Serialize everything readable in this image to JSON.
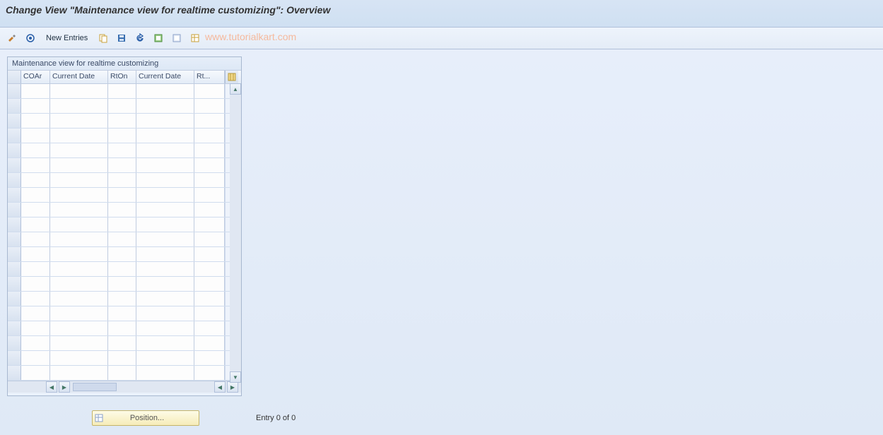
{
  "title": "Change View \"Maintenance view for realtime customizing\": Overview",
  "toolbar": {
    "new_entries": "New Entries"
  },
  "watermark": "www.tutorialkart.com",
  "panel": {
    "title": "Maintenance view for realtime customizing",
    "columns": {
      "coar": "COAr",
      "cd1": "Current Date",
      "rton": "RtOn",
      "cd2": "Current Date",
      "rt": "Rt..."
    },
    "row_count": 21
  },
  "footer": {
    "position_label": "Position...",
    "entry_text": "Entry 0 of 0"
  }
}
